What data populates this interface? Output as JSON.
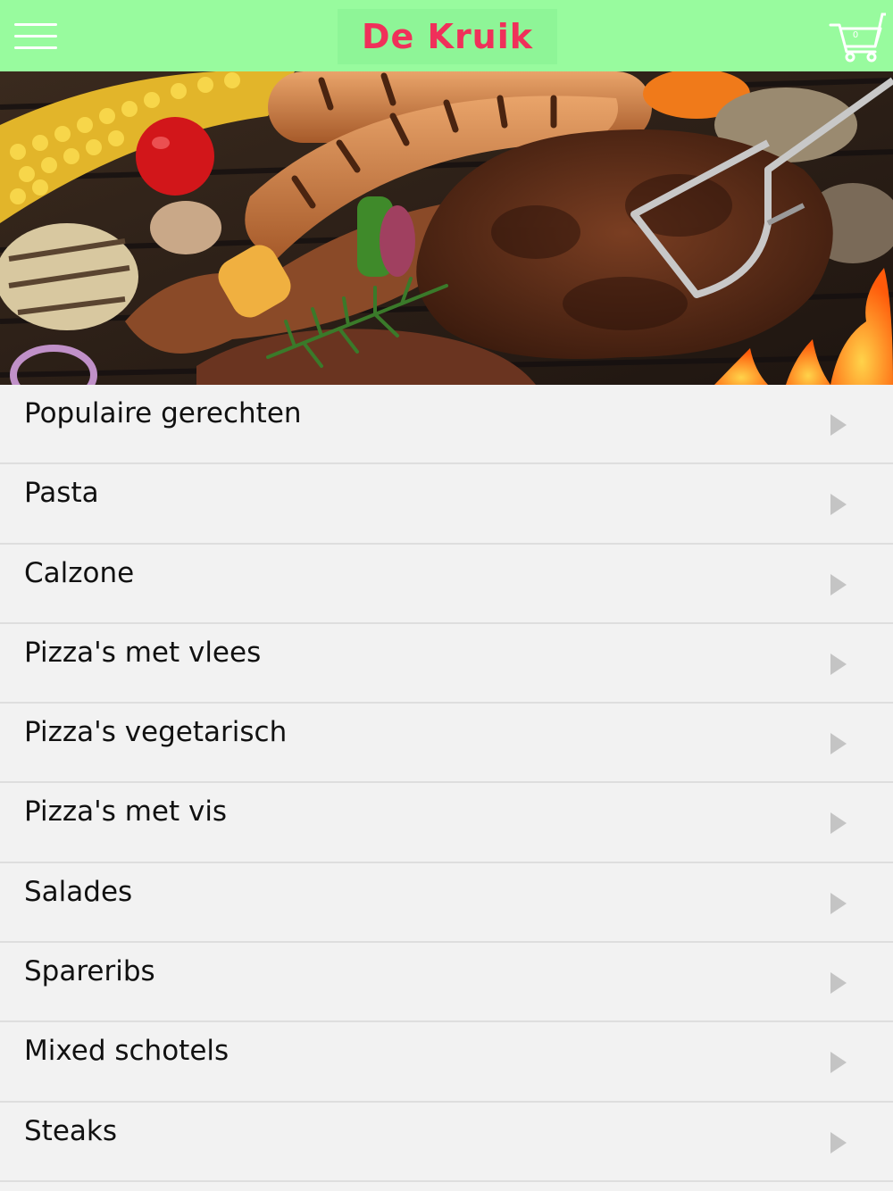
{
  "header": {
    "logo_text": "De Kruik",
    "cart_count": "0"
  },
  "colors": {
    "header_bg": "#98fb9e",
    "logo_color": "#f0305a",
    "list_bg": "#f2f2f2"
  },
  "icons": {
    "menu": "hamburger-icon",
    "cart": "cart-icon",
    "item_arrow": "chevron-right-icon"
  },
  "hero": {
    "description_icon": "grill-photo"
  },
  "categories": [
    {
      "label": "Populaire gerechten"
    },
    {
      "label": "Pasta"
    },
    {
      "label": "Calzone"
    },
    {
      "label": "Pizza's met vlees"
    },
    {
      "label": "Pizza's vegetarisch"
    },
    {
      "label": "Pizza's met vis"
    },
    {
      "label": "Salades"
    },
    {
      "label": "Spareribs"
    },
    {
      "label": "Mixed schotels"
    },
    {
      "label": "Steaks"
    }
  ]
}
